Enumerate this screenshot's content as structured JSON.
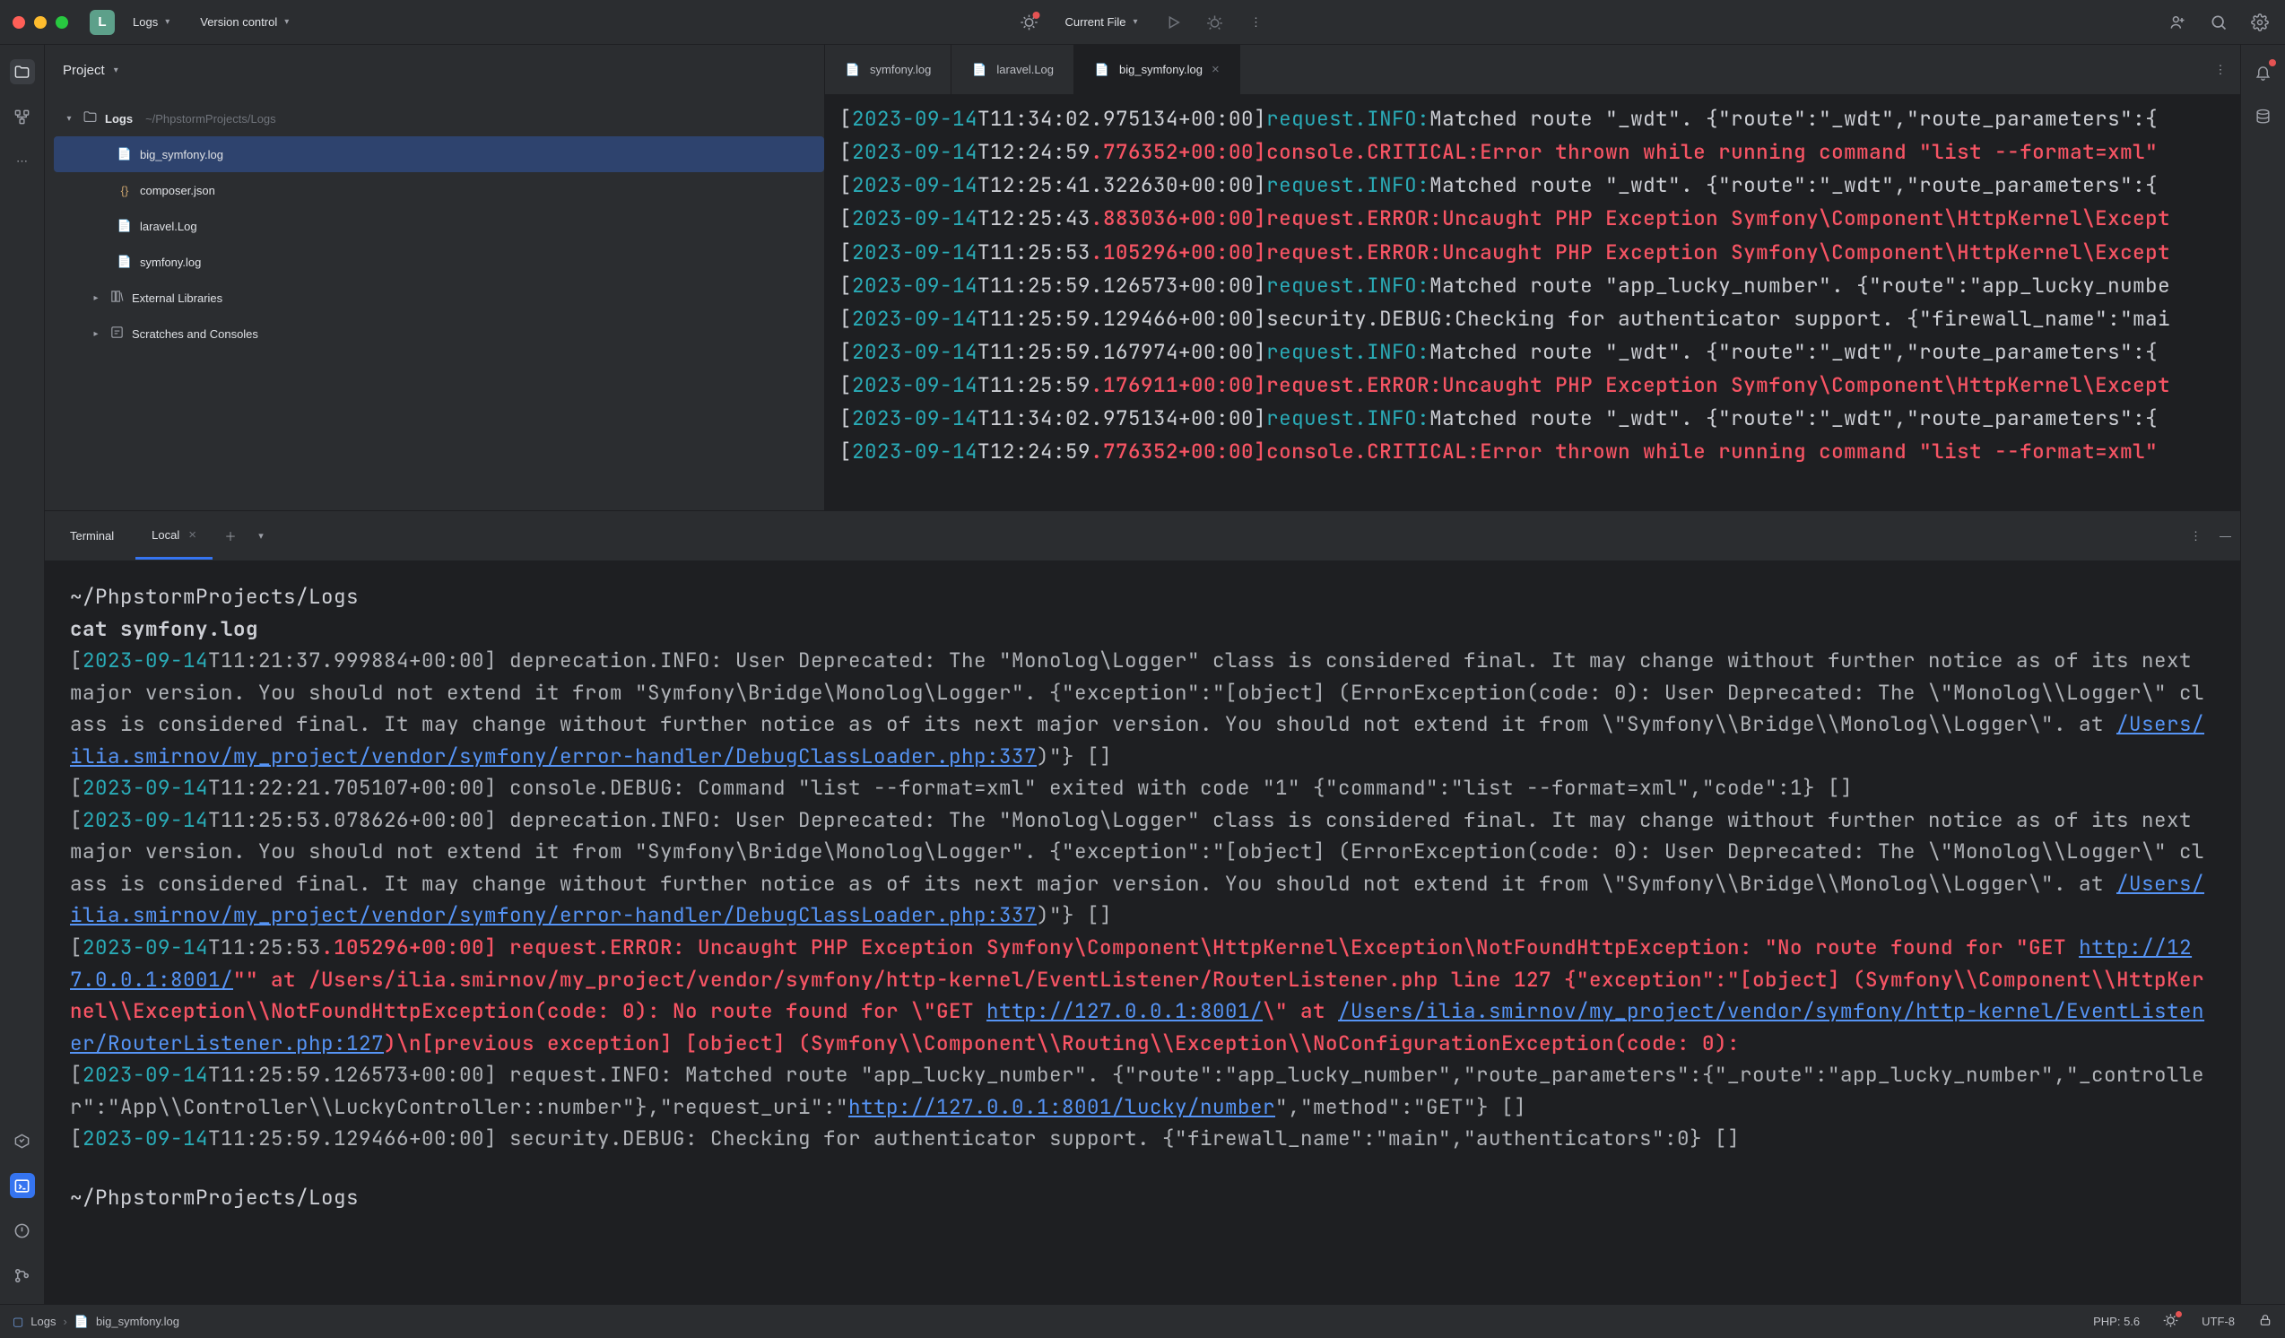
{
  "titlebar": {
    "project_initial": "L",
    "project_name": "Logs",
    "version_control": "Version control",
    "current_file": "Current File"
  },
  "project_panel": {
    "header": "Project",
    "root_name": "Logs",
    "root_path": "~/PhpstormProjects/Logs",
    "files": {
      "big_symfony": "big_symfony.log",
      "composer": "composer.json",
      "laravel": "laravel.Log",
      "symfony": "symfony.log"
    },
    "external_libs": "External Libraries",
    "scratches": "Scratches and Consoles"
  },
  "tabs": {
    "t0": "symfony.log",
    "t1": "laravel.Log",
    "t2": "big_symfony.log"
  },
  "log_lines": [
    {
      "date": "2023-09-14",
      "time": "T11:34:02",
      "ms": ".975134+00:00]",
      "level": "request.INFO:",
      "msg": " Matched route \"_wdt\". {\"route\":\"_wdt\",\"route_parameters\":{",
      "kind": "info"
    },
    {
      "date": "2023-09-14",
      "time": "T12:24:59",
      "ms": ".776352+00:00]",
      "level": "console.CRITICAL:",
      "msg": " Error thrown while running command \"list --format=xml\"",
      "kind": "err"
    },
    {
      "date": "2023-09-14",
      "time": "T12:25:41",
      "ms": ".322630+00:00]",
      "level": "request.INFO:",
      "msg": " Matched route \"_wdt\". {\"route\":\"_wdt\",\"route_parameters\":{",
      "kind": "info"
    },
    {
      "date": "2023-09-14",
      "time": "T12:25:43",
      "ms": ".883036+00:00]",
      "level": "request.ERROR:",
      "msg": " Uncaught PHP Exception Symfony\\Component\\HttpKernel\\Except",
      "kind": "err"
    },
    {
      "date": "2023-09-14",
      "time": "T11:25:53",
      "ms": ".105296+00:00]",
      "level": "request.ERROR:",
      "msg": " Uncaught PHP Exception Symfony\\Component\\HttpKernel\\Except",
      "kind": "err"
    },
    {
      "date": "2023-09-14",
      "time": "T11:25:59",
      "ms": ".126573+00:00]",
      "level": "request.INFO:",
      "msg": " Matched route \"app_lucky_number\". {\"route\":\"app_lucky_numbe",
      "kind": "info"
    },
    {
      "date": "2023-09-14",
      "time": "T11:25:59",
      "ms": ".129466+00:00]",
      "level": "security.DEBUG:",
      "msg": " Checking for authenticator support. {\"firewall_name\":\"mai",
      "kind": "debug"
    },
    {
      "date": "2023-09-14",
      "time": "T11:25:59",
      "ms": ".167974+00:00]",
      "level": "request.INFO:",
      "msg": " Matched route \"_wdt\". {\"route\":\"_wdt\",\"route_parameters\":{",
      "kind": "info"
    },
    {
      "date": "2023-09-14",
      "time": "T11:25:59",
      "ms": ".176911+00:00]",
      "level": "request.ERROR:",
      "msg": " Uncaught PHP Exception Symfony\\Component\\HttpKernel\\Except",
      "kind": "err"
    },
    {
      "date": "2023-09-14",
      "time": "T11:34:02",
      "ms": ".975134+00:00]",
      "level": "request.INFO:",
      "msg": " Matched route \"_wdt\". {\"route\":\"_wdt\",\"route_parameters\":{",
      "kind": "info"
    },
    {
      "date": "2023-09-14",
      "time": "T12:24:59",
      "ms": ".776352+00:00]",
      "level": "console.CRITICAL:",
      "msg": " Error thrown while running command \"list --format=xml\"",
      "kind": "err"
    }
  ],
  "terminal": {
    "title": "Terminal",
    "tab": "Local",
    "cwd": "~/PhpstormProjects/Logs",
    "cmd": "cat symfony.log",
    "link1": "/Users/ilia.smirnov/my_project/vendor/symfony/error-handler/DebugClassLoader.php:337",
    "link2": "/Users/ilia.smirnov/my_project/vendor/symfony/error-handler/DebugClassLoader.php:337",
    "url1": "http://127.0.0.1:8001/",
    "url2": "http://127.0.0.1:8001/",
    "link3": "/Users/ilia.smirnov/my_project/vendor/symfony/http-kernel/EventListener/RouterListener.php:127",
    "url3": "http://127.0.0.1:8001/lucky/number",
    "footer_cwd": "~/PhpstormProjects/Logs",
    "blk1a": "T11:21:37.999884+00:00] deprecation.INFO: User Deprecated: The \"Monolog\\Logger\" class is considered final. It may change without further notice as of its next major version. You should not extend it from \"Symfony\\Bridge\\Monolog\\Logger\". {\"exception\":\"[object] (ErrorException(code: 0): User Deprecated: The \\\"Monolog\\\\Logger\\\" class is considered final. It may change without further notice as of its next major version. You should not extend it from \\\"Symfony\\\\Bridge\\\\Monolog\\\\Logger\\\". at ",
    "blk1b": ")\"} []",
    "blk2": "T11:22:21.705107+00:00] console.DEBUG: Command \"list --format=xml\" exited with code \"1\" {\"command\":\"list --format=xml\",\"code\":1} []",
    "blk3a": "T11:25:53.078626+00:00] deprecation.INFO: User Deprecated: The \"Monolog\\Logger\" class is considered final. It may change without further notice as of its next major version. You should not extend it from \"Symfony\\Bridge\\Monolog\\Logger\". {\"exception\":\"[object] (ErrorException(code: 0): User Deprecated: The \\\"Monolog\\\\Logger\\\" class is considered final. It may change without further notice as of its next major version. You should not extend it from \\\"Symfony\\\\Bridge\\\\Monolog\\\\Logger\\\". at ",
    "blk4_ts": "T11:25:53",
    "blk4a": ".105296+00:00] request.ERROR: Uncaught PHP Exception Symfony\\Component\\HttpKernel\\Exception\\NotFoundHttpException: \"No route found for \"GET ",
    "blk4b": "\"\" at /Users/ilia.smirnov/my_project/vendor/symfony/http-kernel/EventListener/RouterListener.php line 127 {\"exception\":\"[object] (Symfony\\\\Component\\\\HttpKernel\\\\Exception\\\\NotFoundHttpException(code: 0): No route found for \\\"GET ",
    "blk4c": "\\\" at ",
    "blk4d": ")\\n[previous exception] [object] (Symfony\\\\Component\\\\Routing\\\\Exception\\\\NoConfigurationException(code: 0):",
    "blk5a": "T11:25:59.126573+00:00] request.INFO: Matched route \"app_lucky_number\". {\"route\":\"app_lucky_number\",\"route_parameters\":{\"_route\":\"app_lucky_number\",\"_controller\":\"App\\\\Controller\\\\LuckyController::number\"},\"request_uri\":\"",
    "blk5b": "\",\"method\":\"GET\"} []",
    "blk6": "T11:25:59.129466+00:00] security.DEBUG: Checking for authenticator support. {\"firewall_name\":\"main\",\"authenticators\":0} []"
  },
  "statusbar": {
    "crumb_root": "Logs",
    "crumb_file": "big_symfony.log",
    "php": "PHP: 5.6",
    "enc": "UTF-8"
  },
  "date_label": "2023-09-14"
}
